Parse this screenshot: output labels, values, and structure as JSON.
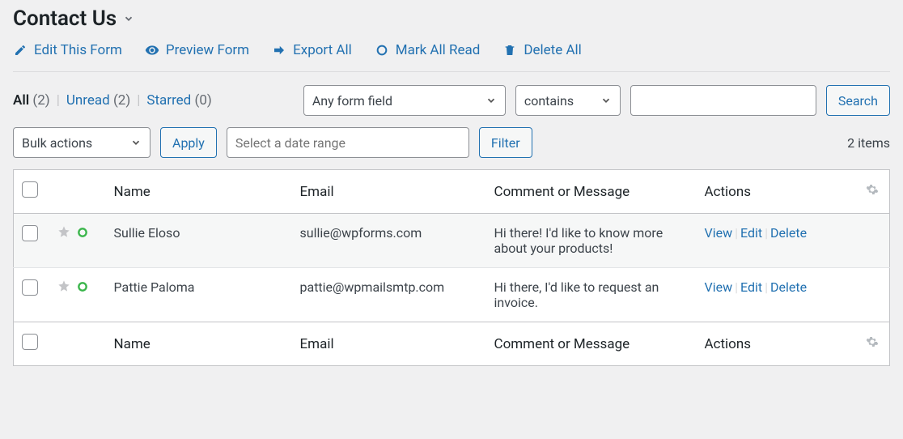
{
  "title": "Contact Us",
  "toolbar": {
    "edit": "Edit This Form",
    "preview": "Preview Form",
    "export": "Export All",
    "mark_read": "Mark All Read",
    "delete": "Delete All"
  },
  "tabs": {
    "all": {
      "label": "All",
      "count": "(2)"
    },
    "unread": {
      "label": "Unread",
      "count": "(2)"
    },
    "starred": {
      "label": "Starred",
      "count": "(0)"
    }
  },
  "filters": {
    "field": "Any form field",
    "operator": "contains",
    "search_value": "",
    "search_btn": "Search",
    "bulk": "Bulk actions",
    "apply": "Apply",
    "date_placeholder": "Select a date range",
    "filter_btn": "Filter"
  },
  "items_text": "2 items",
  "columns": {
    "name": "Name",
    "email": "Email",
    "message": "Comment or Message",
    "actions": "Actions"
  },
  "rows": [
    {
      "name": "Sullie Eloso",
      "email": "sullie@wpforms.com",
      "message": "Hi there! I'd like to know more about your products!"
    },
    {
      "name": "Pattie Paloma",
      "email": "pattie@wpmailsmtp.com",
      "message": "Hi there, I'd like to request an invoice."
    }
  ],
  "actions": {
    "view": "View",
    "edit": "Edit",
    "delete": "Delete"
  }
}
